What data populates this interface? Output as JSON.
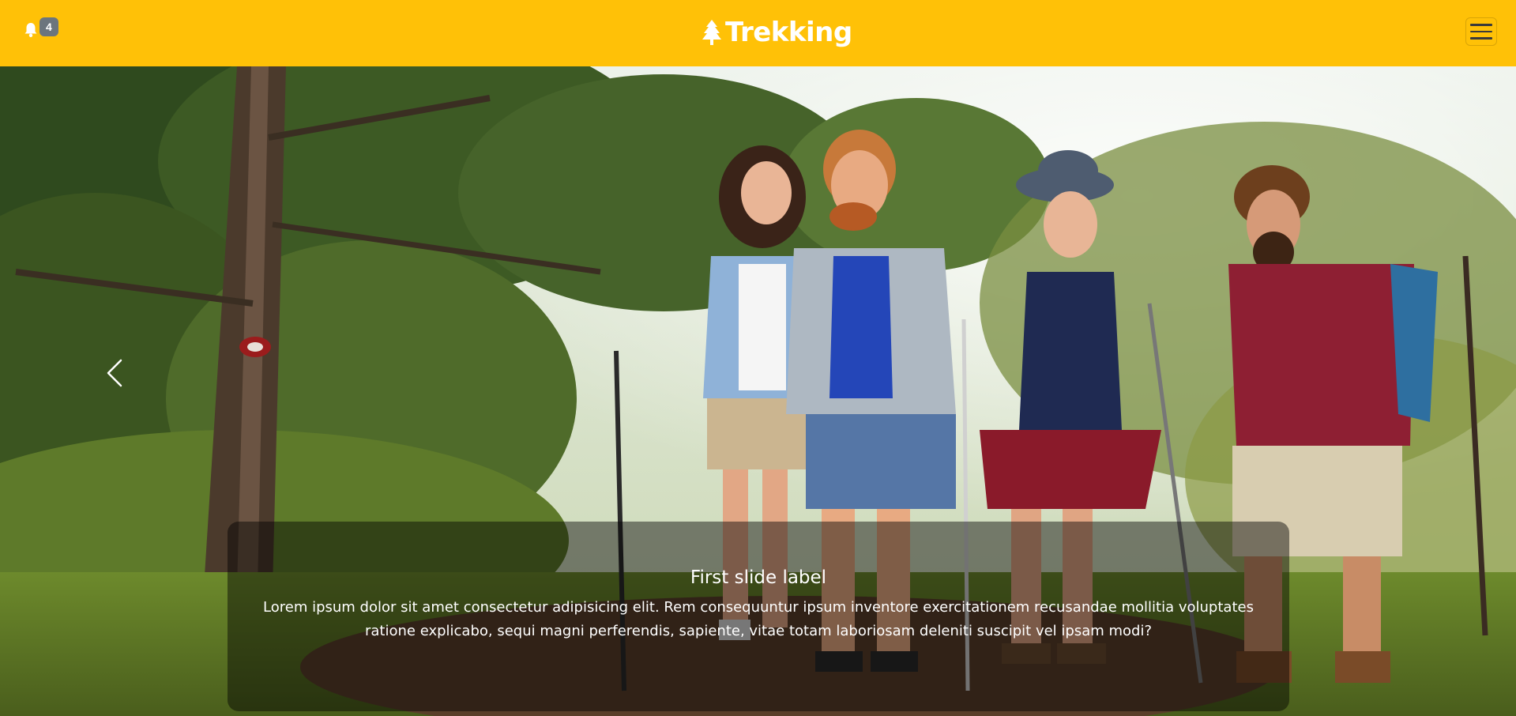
{
  "navbar": {
    "brand_label": "Trekking",
    "brand_icon": "tree-icon",
    "notification_icon": "bell-icon",
    "notification_count": "4",
    "menu_icon": "hamburger-icon",
    "background_color": "#ffc107"
  },
  "carousel": {
    "prev_icon": "chevron-left-icon",
    "slide": {
      "title": "First slide label",
      "text": "Lorem ipsum dolor sit amet consectetur adipisicing elit. Rem consequuntur ipsum inventore exercitationem recusandae mollitia voluptates ratione explicabo, sequi magni perferendis, sapiente, vitae totam laboriosam deleniti suscipit vel ipsam modi?"
    }
  },
  "colors": {
    "accent": "#ffc107",
    "badge": "#6c757d",
    "caption_overlay": "rgba(0,0,0,0.45)"
  }
}
